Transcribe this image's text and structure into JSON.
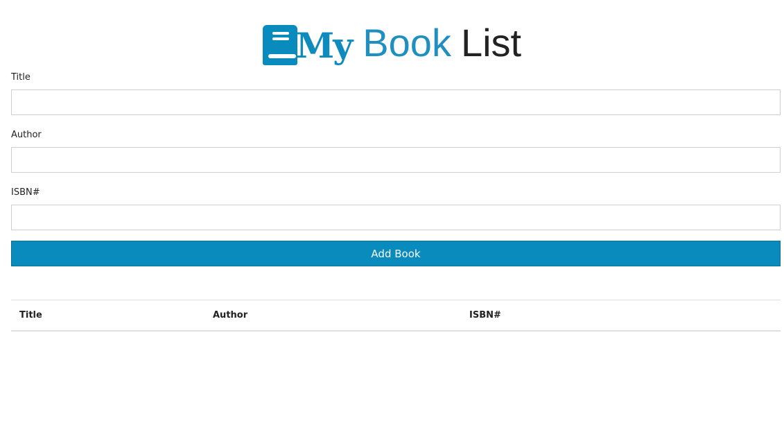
{
  "header": {
    "logo_my": "My",
    "title_book": "Book",
    "title_list": "List"
  },
  "form": {
    "title_label": "Title",
    "title_value": "",
    "author_label": "Author",
    "author_value": "",
    "isbn_label": "ISBN#",
    "isbn_value": "",
    "submit_label": "Add Book"
  },
  "table": {
    "columns": [
      "Title",
      "Author",
      "ISBN#"
    ],
    "rows": []
  },
  "colors": {
    "accent": "#0a8bbd",
    "text": "#222222",
    "border": "#cfcfcf"
  },
  "icons": {
    "logo": "book-icon"
  }
}
